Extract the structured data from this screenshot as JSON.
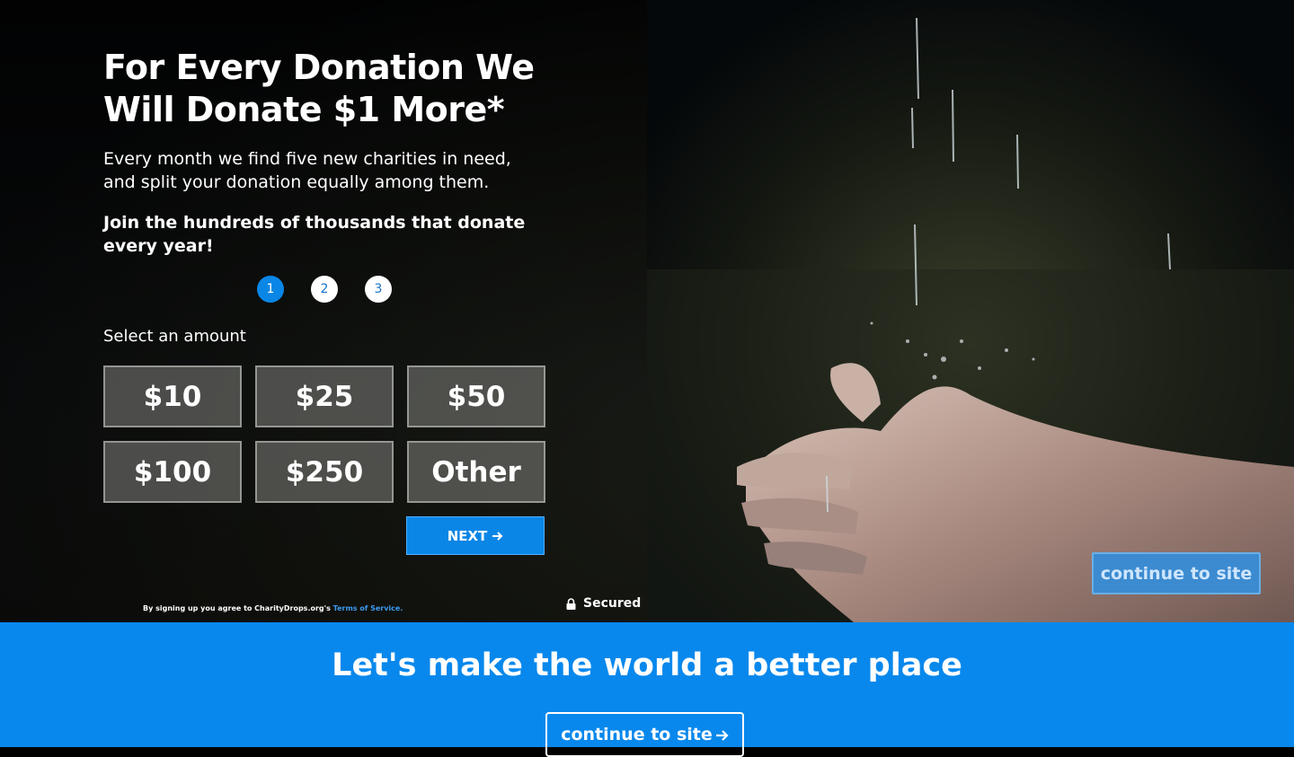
{
  "hero": {
    "headline_line1": "For Every Donation We",
    "headline_line2": "Will Donate $1 More*",
    "subtitle": "Every month we find five new charities in need, and split your donation equally among them.",
    "join_text": "Join the hundreds of thousands that donate every year!"
  },
  "steps": [
    {
      "label": "1",
      "active": true
    },
    {
      "label": "2",
      "active": false
    },
    {
      "label": "3",
      "active": false
    }
  ],
  "amount_section": {
    "label": "Select an amount",
    "options": [
      "$10",
      "$25",
      "$50",
      "$100",
      "$250",
      "Other"
    ]
  },
  "next_button": {
    "label": "NEXT",
    "icon": "arrow-right-icon"
  },
  "footer_note": {
    "text": "By signing up you agree to CharityDrops.org's",
    "link": "Terms of Service."
  },
  "secured": {
    "label": "Secured",
    "icon": "lock-icon"
  },
  "photo_overlay_button": {
    "label": "continue to site"
  },
  "banner": {
    "title": "Let's make the world a better place",
    "button_label": "continue to site",
    "button_icon": "arrow-right-icon"
  },
  "colors": {
    "accent_blue": "#0888ec",
    "button_blue": "#0a86e6",
    "link_blue": "#3b9bf0"
  }
}
